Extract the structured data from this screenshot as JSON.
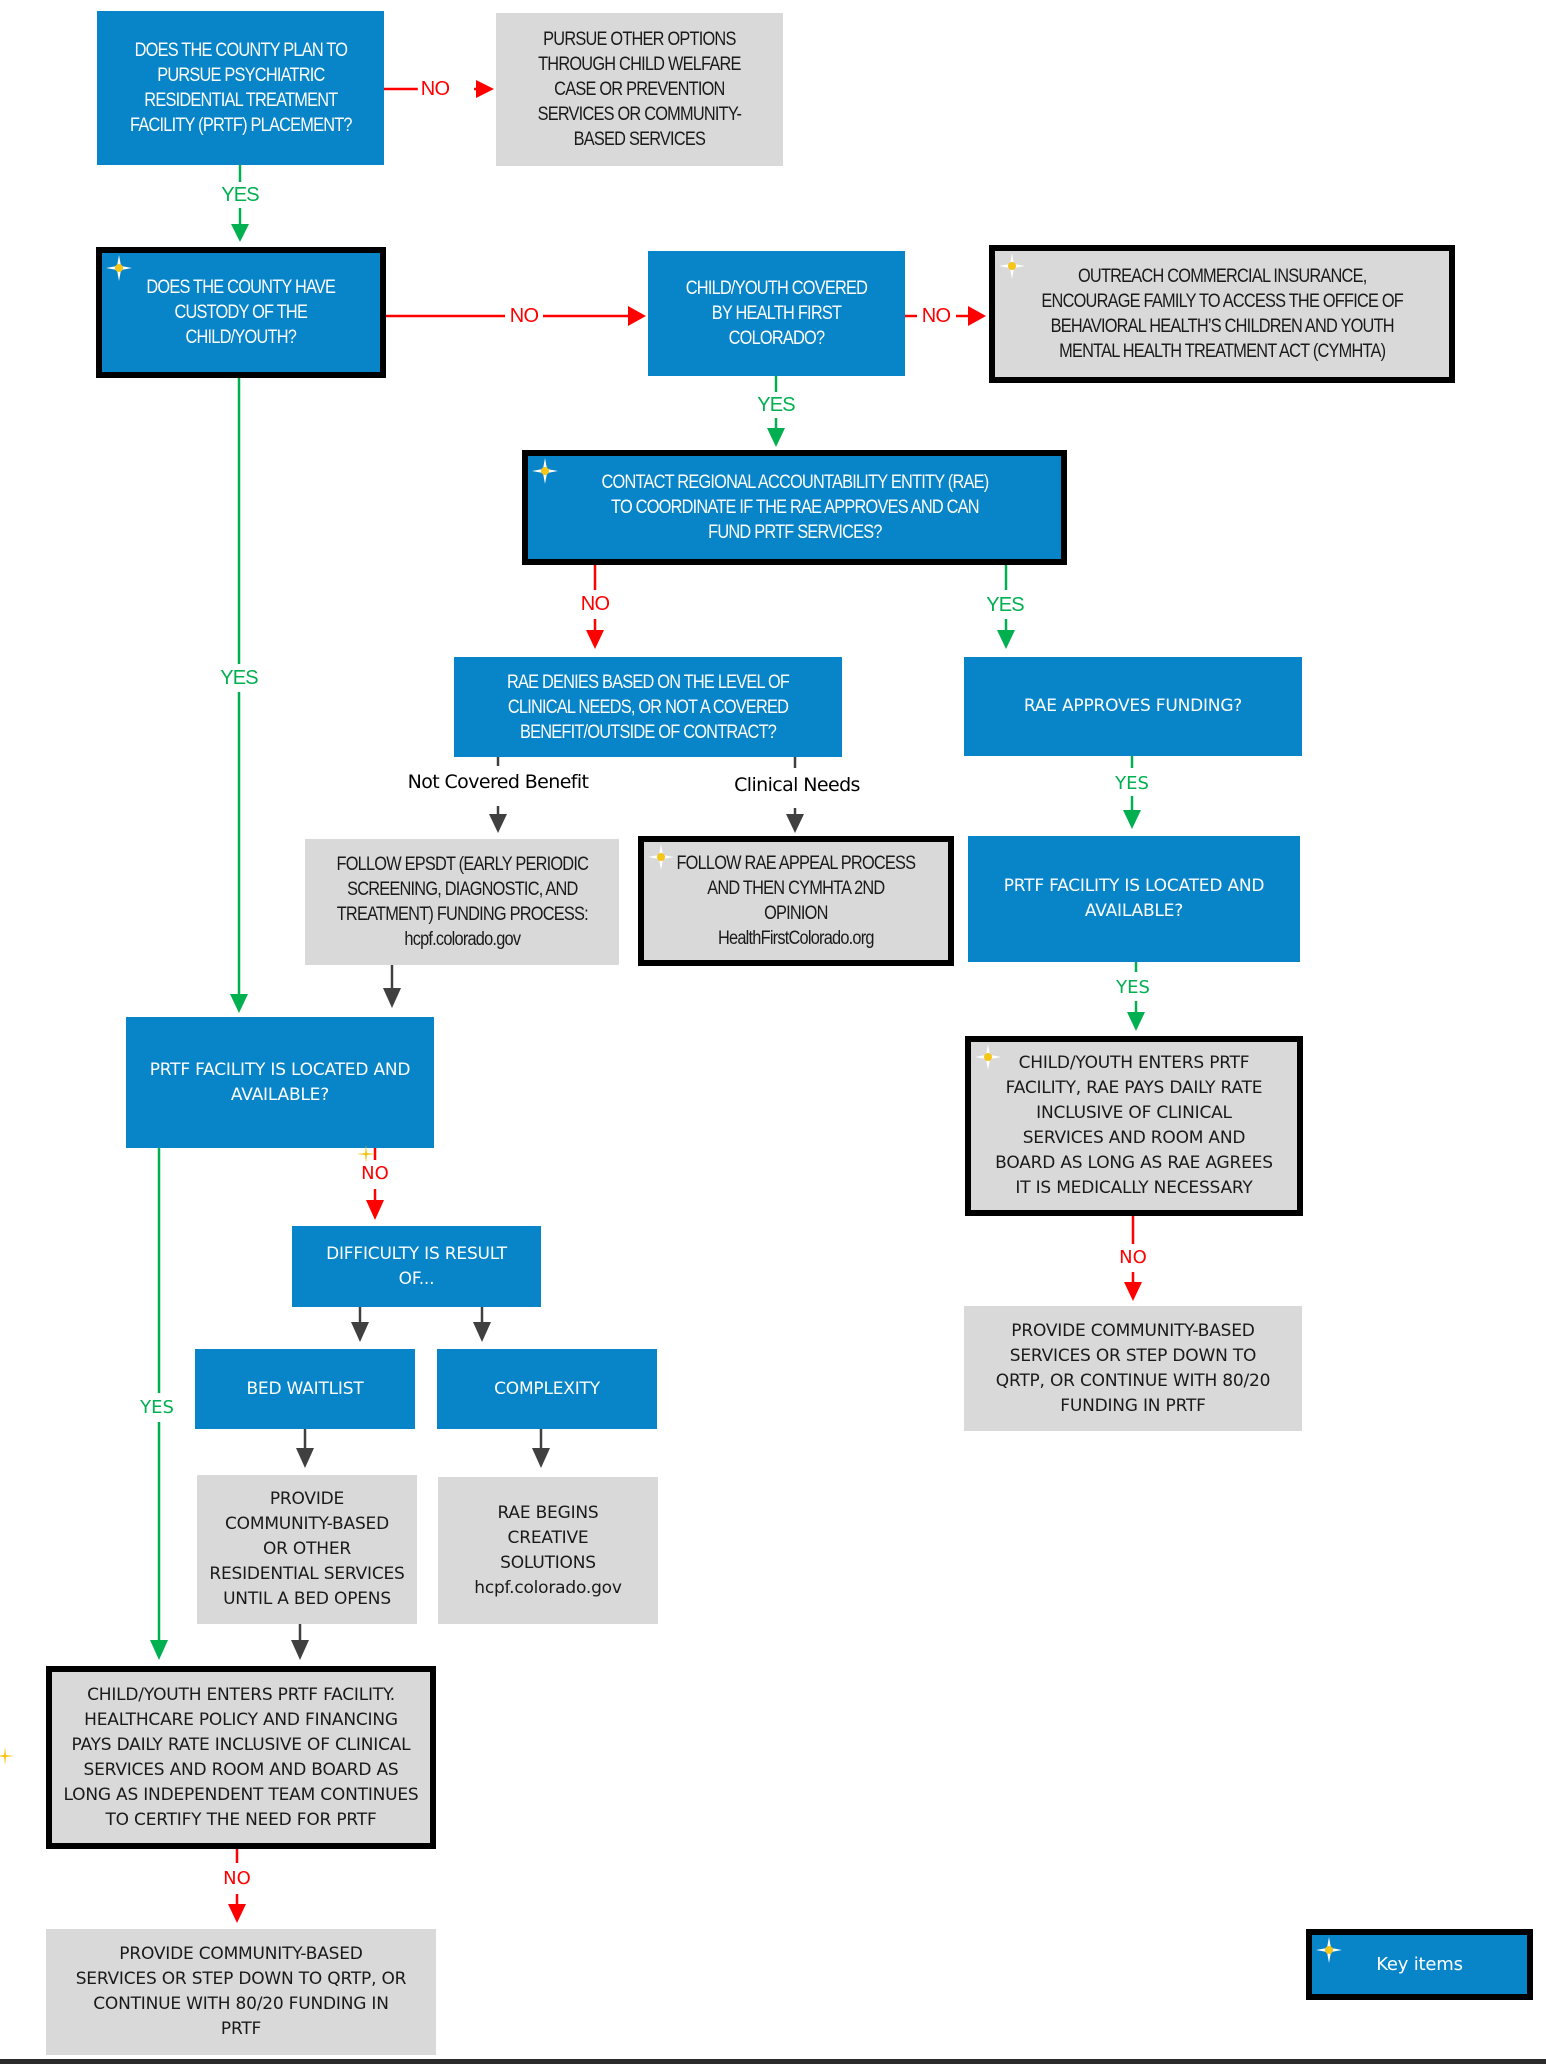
{
  "colors": {
    "decision_blue": "#0785c8",
    "outcome_gray": "#d9d9d9",
    "yes_green": "#00b050",
    "no_red": "#ff0000",
    "neutral_arrow": "#404040",
    "key_border": "#000000"
  },
  "labels": {
    "yes": "YES",
    "no": "NO",
    "not_covered_benefit": "Not Covered Benefit",
    "clinical_needs": "Clinical Needs"
  },
  "nodes": {
    "q_pursue_prtf": "DOES THE COUNTY PLAN TO\nPURSUE PSYCHIATRIC\nRESIDENTIAL TREATMENT\nFACILITY (PRTF) PLACEMENT?",
    "pursue_other_options": "PURSUE OTHER OPTIONS\nTHROUGH CHILD WELFARE\nCASE OR PREVENTION\nSERVICES OR COMMUNITY-\nBASED SERVICES",
    "q_custody": "DOES THE COUNTY HAVE\nCUSTODY OF THE\nCHILD/YOUTH?",
    "q_covered_hfc": "CHILD/YOUTH COVERED\nBY HEALTH FIRST\nCOLORADO?",
    "outreach_commercial": "OUTREACH COMMERCIAL INSURANCE,\nENCOURAGE FAMILY TO ACCESS THE OFFICE OF\nBEHAVIORAL HEALTH’S CHILDREN AND YOUTH\nMENTAL HEALTH TREATMENT ACT (CYMHTA)",
    "contact_rae": "CONTACT REGIONAL ACCOUNTABILITY ENTITY (RAE)\nTO COORDINATE IF THE RAE APPROVES AND CAN\nFUND PRTF SERVICES?",
    "q_rae_denies": "RAE DENIES BASED ON THE LEVEL OF\nCLINICAL NEEDS, OR NOT A COVERED\nBENEFIT/OUTSIDE OF CONTRACT?",
    "q_rae_approves": "RAE APPROVES FUNDING?",
    "follow_epsdt": "FOLLOW EPSDT (EARLY PERIODIC\nSCREENING, DIAGNOSTIC, AND\nTREATMENT) FUNDING PROCESS:\nhcpf.colorado.gov",
    "follow_rae_appeal": "FOLLOW RAE APPEAL PROCESS\nAND THEN CYMHTA 2ND\nOPINION\nHealthFirstColorado.org",
    "q_prtf_located_right": "PRTF FACILITY IS LOCATED AND\nAVAILABLE?",
    "enters_prtf_rae": "CHILD/YOUTH ENTERS PRTF\nFACILITY, RAE PAYS DAILY RATE\nINCLUSIVE OF CLINICAL\nSERVICES AND ROOM AND\nBOARD AS LONG AS RAE AGREES\nIT IS MEDICALLY NECESSARY",
    "provide_community_right": "PROVIDE COMMUNITY-BASED\nSERVICES OR STEP DOWN TO\nQRTP, OR CONTINUE WITH 80/20\nFUNDING IN PRTF",
    "q_prtf_located_left": "PRTF FACILITY IS LOCATED AND\nAVAILABLE?",
    "difficulty_result": "DIFFICULTY IS RESULT\nOF...",
    "bed_waitlist": "BED WAITLIST",
    "complexity": "COMPLEXITY",
    "provide_community_residential": "PROVIDE\nCOMMUNITY-BASED\nOR OTHER\nRESIDENTIAL SERVICES\nUNTIL A BED OPENS",
    "rae_creative_solutions": "RAE BEGINS\nCREATIVE\nSOLUTIONS\nhcpf.colorado.gov",
    "enters_prtf_hcpf": "CHILD/YOUTH ENTERS PRTF FACILITY.\nHEALTHCARE POLICY AND FINANCING\nPAYS DAILY RATE INCLUSIVE OF CLINICAL\nSERVICES AND ROOM AND BOARD AS\nLONG AS INDEPENDENT TEAM CONTINUES\nTO CERTIFY THE NEED FOR PRTF",
    "provide_community_left": "PROVIDE COMMUNITY-BASED\nSERVICES OR STEP DOWN TO QRTP, OR\nCONTINUE WITH 80/20 FUNDING IN\nPRTF"
  },
  "legend": {
    "key_items": "Key items",
    "icon": "sparkle-star-icon"
  }
}
